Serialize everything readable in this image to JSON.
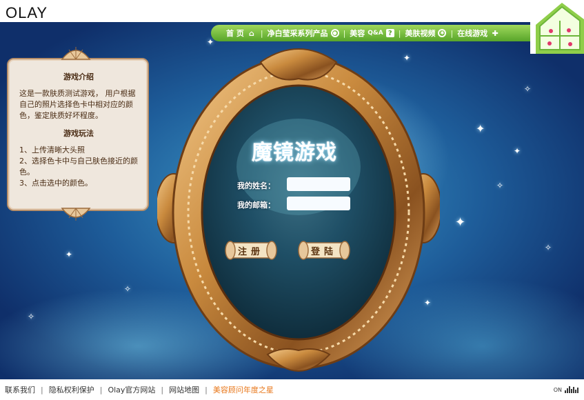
{
  "header": {
    "logo": "OLAY"
  },
  "nav": {
    "items": [
      {
        "label": "首 页",
        "icon": "home-icon"
      },
      {
        "label": "净白莹采系列产品",
        "icon": "target-icon"
      },
      {
        "label": "美容",
        "extra": "Q&A",
        "icon": "question-icon"
      },
      {
        "label": "美肤视频",
        "icon": "film-reel-icon"
      },
      {
        "label": "在线游戏",
        "icon": "puzzle-icon"
      }
    ]
  },
  "intro": {
    "title": "游戏介绍",
    "description": "这是一款肤质测试游戏， 用户根据自己的照片选择色卡中相对应的颜色，鉴定肤质好坏程度。",
    "rules_title": "游戏玩法",
    "rules": [
      "1、上传清晰大头照",
      "2、选择色卡中与自己肤色接近的颜色。",
      "3、点击选中的颜色。"
    ]
  },
  "game": {
    "title": "魔镜游戏",
    "name_label": "我的姓名：",
    "email_label": "我的邮箱：",
    "name_value": "",
    "email_value": "",
    "register_label": "注册",
    "login_label": "登陆"
  },
  "footer": {
    "links": [
      "联系我们",
      "隐私权利保护",
      "Olay官方网站",
      "网站地图",
      "美容顾问年度之星"
    ],
    "on_label": "ON"
  },
  "colors": {
    "nav_green": "#6cb53a",
    "highlight_orange": "#e8771a",
    "panel_bg": "#efe7dd",
    "frame_gold": "#c98a3e"
  }
}
